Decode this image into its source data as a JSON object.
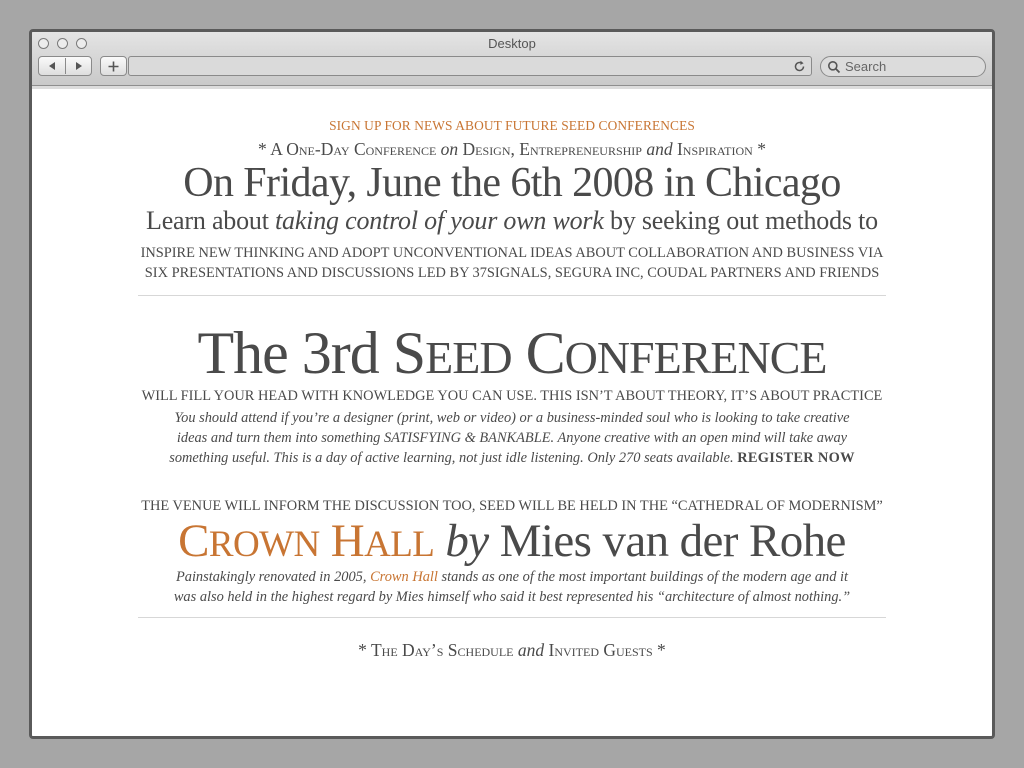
{
  "window": {
    "title": "Desktop",
    "search_placeholder": "Search",
    "address_value": ""
  },
  "colors": {
    "accent": "#c87533",
    "text": "#4a4a4a"
  },
  "page": {
    "signup_link": "SIGN UP FOR NEWS ABOUT FUTURE SEED CONFERENCES",
    "tagline": {
      "pre": "* A One-Day Conference ",
      "on": "on",
      "mid": " Design, Entrepreneurship ",
      "and": "and",
      "post": " Inspiration *"
    },
    "date_heading": "On Friday, June the 6th 2008 in Chicago",
    "learn": {
      "pre": "Learn about ",
      "emphasis": "taking control of your own work",
      "post": " by seeking out methods to"
    },
    "inspire_line1": "INSPIRE NEW THINKING AND ADOPT UNCONVENTIONAL IDEAS ABOUT COLLABORATION AND BUSINESS VIA",
    "inspire_line2": "SIX PRESENTATIONS AND DISCUSSIONS LED BY 37SIGNALS, SEGURA INC, COUDAL PARTNERS AND FRIENDS",
    "seed_title": {
      "pre": "The 3rd ",
      "s_cap": "S",
      "s_rest": "EED",
      "c_cap": "C",
      "c_rest": "ONFERENCE"
    },
    "fill_line": "WILL FILL YOUR HEAD WITH KNOWLEDGE YOU CAN USE. THIS ISN’T ABOUT THEORY, IT’S ABOUT PRACTICE",
    "attend_line1": "You should attend if you’re a designer (print, web or video) or a business-minded soul who is looking to take creative",
    "attend_line2": "ideas and turn them into something SATISFYING & BANKABLE. Anyone creative with an open mind will take away",
    "attend_line3": "something useful. This is a day of active learning, not just idle listening. Only 270 seats available. ",
    "register_link": "REGISTER NOW",
    "venue_line": "THE VENUE WILL INFORM THE DISCUSSION TOO, SEED WILL BE HELD IN THE “CATHEDRAL OF MODERNISM”",
    "crown": {
      "c_cap": "C",
      "c_rest": "ROWN",
      "h_cap": "H",
      "h_rest": "ALL",
      "by": "by",
      "architect": "Mies van der Rohe"
    },
    "reno": {
      "pre": "Painstakingly renovated in 2005, ",
      "link": "Crown Hall",
      "post": " stands as one of the most important buildings of the modern age and it",
      "line2": "was also held in the highest regard by Mies himself who said it best represented his “architecture of almost nothing.”"
    },
    "schedule": {
      "pre": "* The Day’s Schedule ",
      "and": "and",
      "post": " Invited Guests *"
    }
  }
}
